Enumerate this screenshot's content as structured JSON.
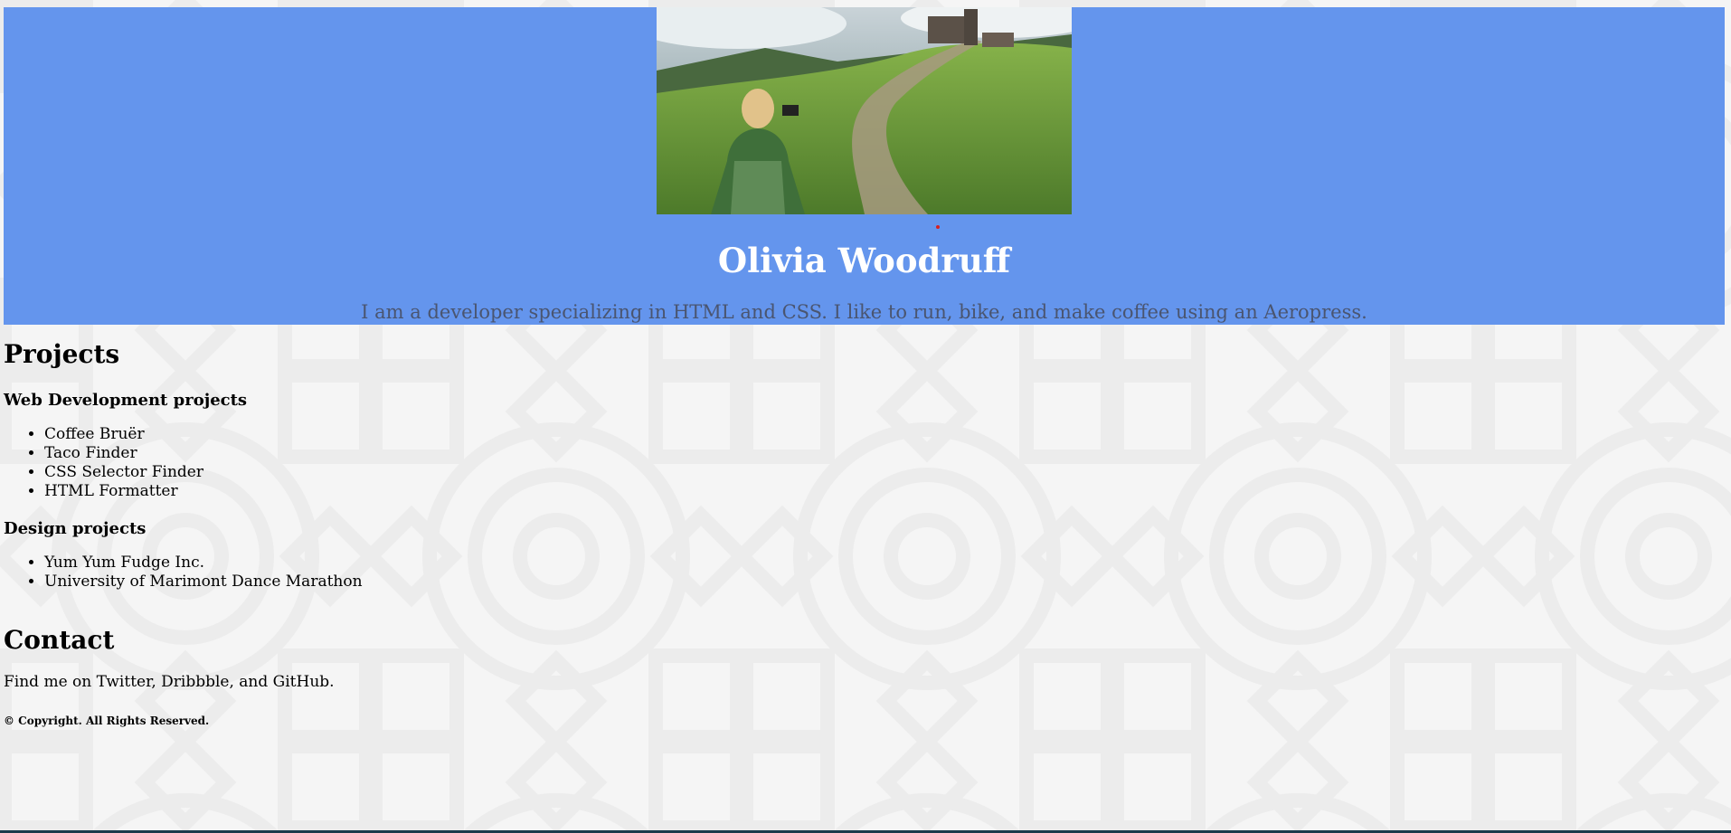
{
  "colors": {
    "header_background": "#6495ed",
    "name_text": "#ffffff",
    "tagline_text": "#4a5570",
    "page_background": "#f5f5f5"
  },
  "header": {
    "image_icon": "hiker-photo",
    "name": "Olivia Woodruff",
    "tagline": "I am a developer specializing in HTML and CSS. I like to run, bike, and make coffee using an Aeropress."
  },
  "projects": {
    "title": "Projects",
    "web": {
      "title": "Web Development projects",
      "items": [
        "Coffee Bruër",
        "Taco Finder",
        "CSS Selector Finder",
        "HTML Formatter"
      ]
    },
    "design": {
      "title": "Design projects",
      "items": [
        "Yum Yum Fudge Inc.",
        "University of Marimont Dance Marathon"
      ]
    }
  },
  "contact": {
    "title": "Contact",
    "text": "Find me on Twitter, Dribbble, and GitHub."
  },
  "footer": {
    "copyright": "© Copyright. All Rights Reserved."
  }
}
